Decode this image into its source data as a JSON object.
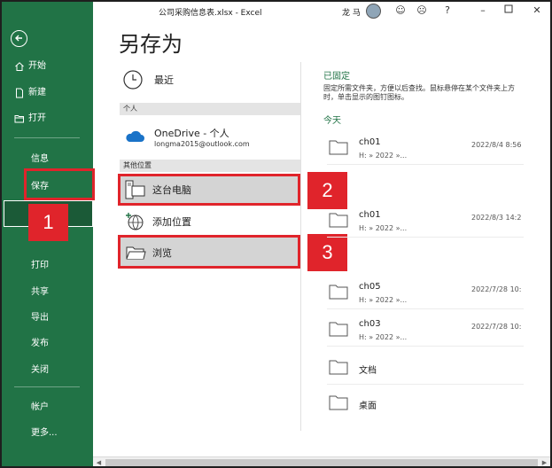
{
  "window": {
    "title": "公司采购信息表.xlsx  -  Excel",
    "user_name": "龙 马",
    "help": "?"
  },
  "sidebar": {
    "items": [
      {
        "label": "开始"
      },
      {
        "label": "新建"
      },
      {
        "label": "打开"
      }
    ],
    "info": "信息",
    "save": "保存",
    "print": "打印",
    "share": "共享",
    "export": "导出",
    "publish": "发布",
    "close": "关闭",
    "account": "帐户",
    "more": "更多..."
  },
  "page": {
    "title": "另存为"
  },
  "locations": {
    "recent": "最近",
    "personal_header": "个人",
    "onedrive_name": "OneDrive - 个人",
    "onedrive_email": "longma2015@outlook.com",
    "other_header": "其他位置",
    "this_pc": "这台电脑",
    "add_place": "添加位置",
    "browse": "浏览"
  },
  "pinned": {
    "title": "已固定",
    "description": "固定所需文件夹，方便以后查找。鼠标悬停在某个文件夹上方时，单击显示的图钉图标。",
    "today": "今天"
  },
  "folders": [
    {
      "name": "ch01",
      "path": "H: » 2022 »...",
      "date": "2022/8/4 8:56"
    },
    {
      "name": "ch01",
      "path": "H: » 2022 »...",
      "date": "2022/8/3 14:2"
    },
    {
      "name": "ch05",
      "path": "H: » 2022 »...",
      "date": "2022/7/28 10:"
    },
    {
      "name": "ch03",
      "path": "H: » 2022 »...",
      "date": "2022/7/28 10:"
    },
    {
      "name": "文档"
    },
    {
      "name": "桌面"
    }
  ],
  "callouts": {
    "one": "1",
    "two": "2",
    "three": "3"
  },
  "colors": {
    "excel_green": "#217346",
    "callout_red": "#e0242b",
    "selected_gray": "#d4d4d4"
  }
}
